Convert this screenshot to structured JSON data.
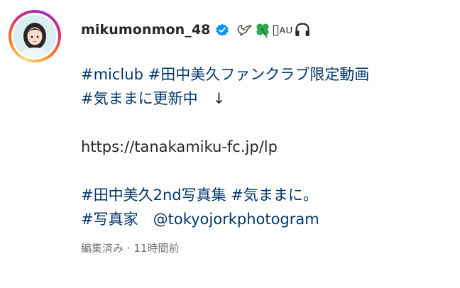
{
  "post": {
    "username": "mikumonmon_48",
    "bio_suffix_text": "AU",
    "icons": {
      "verified": "verified-badge-icon",
      "emoji_1": "dove-icon",
      "emoji_2": "four-leaf-clover-icon",
      "emoji_3": "missing-glyph-icon",
      "emoji_4": "headphones-icon"
    },
    "caption": {
      "line1": [
        {
          "type": "hashtag",
          "text": "#miclub"
        },
        {
          "type": "plain",
          "text": " "
        },
        {
          "type": "hashtag",
          "text": "#田中美久ファンクラブ限定動画"
        }
      ],
      "line2": [
        {
          "type": "hashtag",
          "text": "#気ままに更新中"
        },
        {
          "type": "plain",
          "text": "　↓"
        }
      ],
      "url": "https://tanakamiku-fc.jp/lp",
      "line4": [
        {
          "type": "hashtag",
          "text": "#田中美久2nd写真集"
        },
        {
          "type": "plain",
          "text": " "
        },
        {
          "type": "hashtag",
          "text": "#気ままに。"
        }
      ],
      "line5": [
        {
          "type": "hashtag",
          "text": "#写真家"
        },
        {
          "type": "plain",
          "text": "　"
        },
        {
          "type": "mention",
          "text": "@tokyojorkphotogram"
        }
      ]
    },
    "meta": {
      "edited": "編集済み",
      "separator": " · ",
      "time": "11時間前"
    },
    "colors": {
      "link": "#00376b",
      "text": "#262626",
      "meta": "#737373",
      "verified": "#0095f6"
    }
  }
}
